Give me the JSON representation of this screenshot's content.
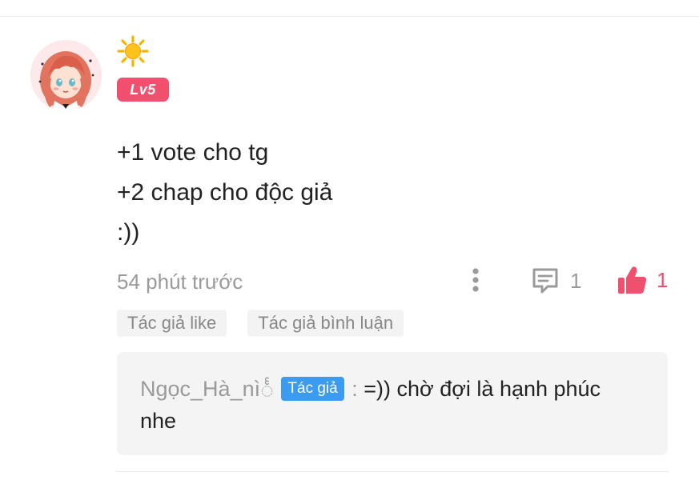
{
  "comment": {
    "user": {
      "avatar_icon": "anime-girl-avatar",
      "name_icon": "sun-emoji",
      "level": "Lv5"
    },
    "lines": [
      "+1 vote cho tg",
      "+2 chap cho độc giả",
      ":))"
    ],
    "timestamp": "54 phút trước",
    "reply_count": "1",
    "like_count": "1",
    "tags": [
      "Tác giả like",
      "Tác giả bình luận"
    ]
  },
  "reply": {
    "author": "Ngọc_Hà_nìင်္",
    "badge": "Tác giả",
    "separator": " : ",
    "text": "=)) chờ đợi là hạnh phúc nhe"
  },
  "colors": {
    "level_badge": "#f0506e",
    "like": "#f0506e",
    "author_badge": "#3a9bf0",
    "muted_text": "#9a9a9a"
  }
}
